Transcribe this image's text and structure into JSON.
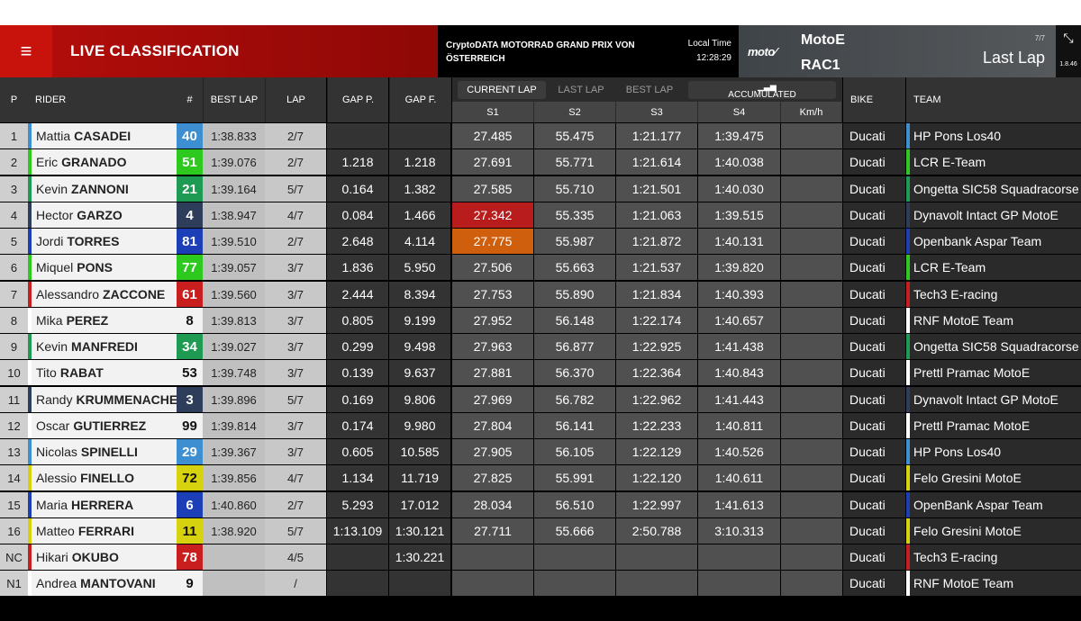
{
  "header": {
    "menu_icon": "≡",
    "title": "LIVE CLASSIFICATION",
    "event": "CryptoDATA MOTORRAD GRAND PRIX VON ÖSTERREICH",
    "local_time_label": "Local Time",
    "local_time": "12:28:29",
    "series_logo": "moto⁄",
    "category": "MotoE",
    "session": "RAC1",
    "lap_count": "7/7",
    "view_mode": "Last Lap",
    "expand_icon": "⤡",
    "strip_value": "1.8.46"
  },
  "columns": {
    "p": "P",
    "rider": "RIDER",
    "num": "#",
    "best_lap": "BEST LAP",
    "lap": "LAP",
    "gap_p": "GAP P.",
    "gap_f": "GAP F.",
    "bike": "BIKE",
    "team": "TEAM"
  },
  "tabs": {
    "current_lap": "CURRENT LAP",
    "last_lap": "LAST LAP",
    "best_lap": "BEST LAP",
    "accumulated": "ACCUMULATED",
    "accumulated_icon": "bar-chart-icon"
  },
  "subcolumns": {
    "s1": "S1",
    "s2": "S2",
    "s3": "S3",
    "s4": "S4",
    "kmh": "Km/h"
  },
  "colors": {
    "sector_red": "#b81c1c",
    "sector_orange": "#cf5f0c"
  },
  "riders": [
    {
      "pos": "1",
      "first": "Mattia",
      "last": "CASADEI",
      "num": "40",
      "num_color": "#3d8fd1",
      "team_color": "#3d8fd1",
      "best": "1:38.833",
      "lap": "2/7",
      "gap_p": "",
      "gap_f": "",
      "s1": "27.485",
      "s2": "55.475",
      "s3": "1:21.177",
      "s4": "1:39.475",
      "kmh": "",
      "bike": "Ducati",
      "team": "HP Pons Los40"
    },
    {
      "pos": "2",
      "first": "Eric",
      "last": "GRANADO",
      "num": "51",
      "num_color": "#2ec91e",
      "team_color": "#2ec91e",
      "best": "1:39.076",
      "lap": "2/7",
      "gap_p": "1.218",
      "gap_f": "1.218",
      "s1": "27.691",
      "s2": "55.771",
      "s3": "1:21.614",
      "s4": "1:40.038",
      "kmh": "",
      "bike": "Ducati",
      "team": "LCR E-Team"
    },
    {
      "pos": "3",
      "first": "Kevin",
      "last": "ZANNONI",
      "num": "21",
      "num_color": "#1e9a52",
      "team_color": "#1e9a52",
      "best": "1:39.164",
      "lap": "5/7",
      "gap_p": "0.164",
      "gap_f": "1.382",
      "s1": "27.585",
      "s2": "55.710",
      "s3": "1:21.501",
      "s4": "1:40.030",
      "kmh": "",
      "bike": "Ducati",
      "team": "Ongetta SIC58 Squadracorse"
    },
    {
      "pos": "4",
      "first": "Hector",
      "last": "GARZO",
      "num": "4",
      "num_color": "#2e3e5a",
      "team_color": "#2e3e5a",
      "best": "1:38.947",
      "lap": "4/7",
      "gap_p": "0.084",
      "gap_f": "1.466",
      "s1": "27.342",
      "s1_state": "red",
      "s2": "55.335",
      "s3": "1:21.063",
      "s4": "1:39.515",
      "kmh": "",
      "bike": "Ducati",
      "team": "Dynavolt Intact GP MotoE"
    },
    {
      "pos": "5",
      "first": "Jordi",
      "last": "TORRES",
      "num": "81",
      "num_color": "#1c3fb8",
      "team_color": "#1c3fb8",
      "best": "1:39.510",
      "lap": "2/7",
      "gap_p": "2.648",
      "gap_f": "4.114",
      "s1": "27.775",
      "s1_state": "orange",
      "s2": "55.987",
      "s3": "1:21.872",
      "s4": "1:40.131",
      "kmh": "",
      "bike": "Ducati",
      "team": "Openbank Aspar Team"
    },
    {
      "pos": "6",
      "first": "Miquel",
      "last": "PONS",
      "num": "77",
      "num_color": "#2ec91e",
      "team_color": "#2ec91e",
      "best": "1:39.057",
      "lap": "3/7",
      "gap_p": "1.836",
      "gap_f": "5.950",
      "s1": "27.506",
      "s2": "55.663",
      "s3": "1:21.537",
      "s4": "1:39.820",
      "kmh": "",
      "bike": "Ducati",
      "team": "LCR E-Team"
    },
    {
      "pos": "7",
      "first": "Alessandro",
      "last": "ZACCONE",
      "num": "61",
      "num_color": "#c81e1e",
      "team_color": "#c81e1e",
      "best": "1:39.560",
      "lap": "3/7",
      "gap_p": "2.444",
      "gap_f": "8.394",
      "s1": "27.753",
      "s2": "55.890",
      "s3": "1:21.834",
      "s4": "1:40.393",
      "kmh": "",
      "bike": "Ducati",
      "team": "Tech3 E-racing"
    },
    {
      "pos": "8",
      "first": "Mika",
      "last": "PEREZ",
      "num": "8",
      "num_color": "#f2f2f2",
      "num_text": "#111111",
      "team_color": "#ffffff",
      "best": "1:39.813",
      "lap": "3/7",
      "gap_p": "0.805",
      "gap_f": "9.199",
      "s1": "27.952",
      "s2": "56.148",
      "s3": "1:22.174",
      "s4": "1:40.657",
      "kmh": "",
      "bike": "Ducati",
      "team": "RNF MotoE Team"
    },
    {
      "pos": "9",
      "first": "Kevin",
      "last": "MANFREDI",
      "num": "34",
      "num_color": "#1e9a52",
      "team_color": "#1e9a52",
      "best": "1:39.027",
      "lap": "3/7",
      "gap_p": "0.299",
      "gap_f": "9.498",
      "s1": "27.963",
      "s2": "56.877",
      "s3": "1:22.925",
      "s4": "1:41.438",
      "kmh": "",
      "bike": "Ducati",
      "team": "Ongetta SIC58 Squadracorse"
    },
    {
      "pos": "10",
      "first": "Tito",
      "last": "RABAT",
      "num": "53",
      "num_color": "#f2f2f2",
      "num_text": "#111111",
      "team_color": "#ffffff",
      "best": "1:39.748",
      "lap": "3/7",
      "gap_p": "0.139",
      "gap_f": "9.637",
      "s1": "27.881",
      "s2": "56.370",
      "s3": "1:22.364",
      "s4": "1:40.843",
      "kmh": "",
      "bike": "Ducati",
      "team": "Prettl Pramac MotoE"
    },
    {
      "pos": "11",
      "first": "Randy",
      "last": "KRUMMENACHER",
      "num": "3",
      "num_color": "#2e3e5a",
      "team_color": "#2e3e5a",
      "best": "1:39.896",
      "lap": "5/7",
      "gap_p": "0.169",
      "gap_f": "9.806",
      "s1": "27.969",
      "s2": "56.782",
      "s3": "1:22.962",
      "s4": "1:41.443",
      "kmh": "",
      "bike": "Ducati",
      "team": "Dynavolt Intact GP MotoE"
    },
    {
      "pos": "12",
      "first": "Oscar",
      "last": "GUTIERREZ",
      "num": "99",
      "num_color": "#f2f2f2",
      "num_text": "#111111",
      "team_color": "#ffffff",
      "best": "1:39.814",
      "lap": "3/7",
      "gap_p": "0.174",
      "gap_f": "9.980",
      "s1": "27.804",
      "s2": "56.141",
      "s3": "1:22.233",
      "s4": "1:40.811",
      "kmh": "",
      "bike": "Ducati",
      "team": "Prettl Pramac MotoE"
    },
    {
      "pos": "13",
      "first": "Nicolas",
      "last": "SPINELLI",
      "num": "29",
      "num_color": "#3d8fd1",
      "team_color": "#3d8fd1",
      "best": "1:39.367",
      "lap": "3/7",
      "gap_p": "0.605",
      "gap_f": "10.585",
      "s1": "27.905",
      "s2": "56.105",
      "s3": "1:22.129",
      "s4": "1:40.526",
      "kmh": "",
      "bike": "Ducati",
      "team": "HP Pons Los40"
    },
    {
      "pos": "14",
      "first": "Alessio",
      "last": "FINELLO",
      "num": "72",
      "num_color": "#d6d210",
      "num_text": "#111111",
      "team_color": "#d6d210",
      "best": "1:39.856",
      "lap": "4/7",
      "gap_p": "1.134",
      "gap_f": "11.719",
      "s1": "27.825",
      "s2": "55.991",
      "s3": "1:22.120",
      "s4": "1:40.611",
      "kmh": "",
      "bike": "Ducati",
      "team": "Felo Gresini MotoE"
    },
    {
      "pos": "15",
      "first": "Maria",
      "last": "HERRERA",
      "num": "6",
      "num_color": "#1c3fb8",
      "team_color": "#1c3fb8",
      "best": "1:40.860",
      "lap": "2/7",
      "gap_p": "5.293",
      "gap_f": "17.012",
      "s1": "28.034",
      "s2": "56.510",
      "s3": "1:22.997",
      "s4": "1:41.613",
      "kmh": "",
      "bike": "Ducati",
      "team": "OpenBank Aspar Team"
    },
    {
      "pos": "16",
      "first": "Matteo",
      "last": "FERRARI",
      "num": "11",
      "num_color": "#d6d210",
      "num_text": "#111111",
      "team_color": "#d6d210",
      "best": "1:38.920",
      "lap": "5/7",
      "gap_p": "1:13.109",
      "gap_f": "1:30.121",
      "s1": "27.711",
      "s2": "55.666",
      "s3": "2:50.788",
      "s4": "3:10.313",
      "kmh": "",
      "bike": "Ducati",
      "team": "Felo Gresini MotoE"
    },
    {
      "pos": "NC",
      "first": "Hikari",
      "last": "OKUBO",
      "num": "78",
      "num_color": "#c81e1e",
      "team_color": "#c81e1e",
      "best": "",
      "lap": "4/5",
      "gap_p": "",
      "gap_f": "1:30.221",
      "s1": "",
      "s2": "",
      "s3": "",
      "s4": "",
      "kmh": "",
      "bike": "Ducati",
      "team": "Tech3 E-racing"
    },
    {
      "pos": "N1",
      "first": "Andrea",
      "last": "MANTOVANI",
      "num": "9",
      "num_color": "#f2f2f2",
      "num_text": "#111111",
      "team_color": "#ffffff",
      "best": "",
      "lap": "/",
      "gap_p": "",
      "gap_f": "",
      "s1": "",
      "s2": "",
      "s3": "",
      "s4": "",
      "kmh": "",
      "bike": "Ducati",
      "team": "RNF MotoE Team"
    }
  ]
}
